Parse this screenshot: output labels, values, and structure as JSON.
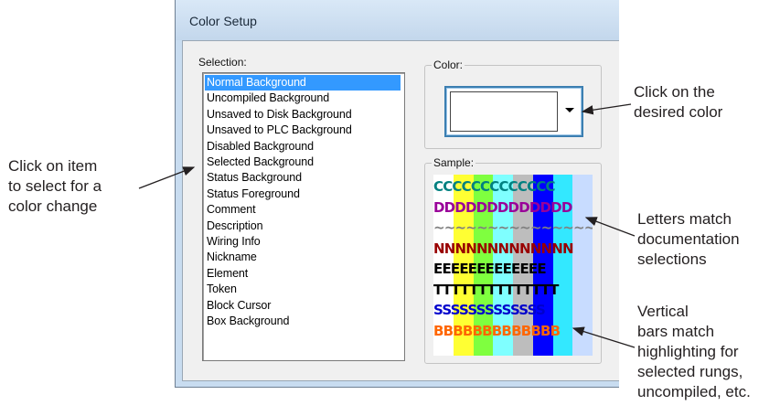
{
  "dialog": {
    "title": "Color Setup"
  },
  "selection": {
    "label": "Selection:",
    "selected_index": 0,
    "items": [
      "Normal Background",
      "Uncompiled Background",
      "Unsaved to Disk Background",
      "Unsaved to PLC Background",
      "Disabled Background",
      "Selected Background",
      "Status Background",
      "Status Foreground",
      "Comment",
      "Description",
      "Wiring Info",
      "Nickname",
      "Element",
      "Token",
      "Block Cursor",
      "Box Background"
    ]
  },
  "color": {
    "label": "Color:",
    "current": "#ffffff",
    "icon": "chevron-down-icon"
  },
  "sample": {
    "label": "Sample:",
    "bars": [
      "#ffffff",
      "#ffff33",
      "#7fff3f",
      "#7fffff",
      "#bdbdbd",
      "#0000ff",
      "#33e8ff",
      "#c8dcff"
    ],
    "rows": [
      {
        "text": "CCCCCCCCCCCCC",
        "color": "#008080"
      },
      {
        "text": "DDDDDDDDDDDDD",
        "color": "#990099"
      },
      {
        "text": "~~~~~~~~~~~~~~~~~~~",
        "color": "#808080"
      },
      {
        "text": "NNNNNNNNNNNNN",
        "color": "#990000"
      },
      {
        "text": "EEEEEEEEEEEEE",
        "color": "#000000"
      },
      {
        "text": "TTTTTTTTTTTTTT",
        "color": "#000000"
      },
      {
        "text": "SSSSSSSSSSSSS",
        "color": "#0000cc"
      },
      {
        "text": "BBBBBBBBBBBBB",
        "color": "#ff6600"
      }
    ]
  },
  "callouts": {
    "color": "Click on the\ndesired color",
    "item": "Click on item\nto select for a\ncolor change",
    "letters": "Letters match\ndocumentation\nselections",
    "bars": "Vertical\nbars match\nhighlighting for\nselected rungs,\nuncompiled, etc."
  }
}
